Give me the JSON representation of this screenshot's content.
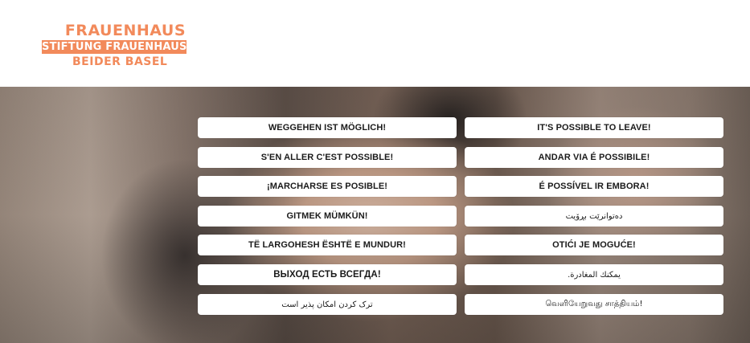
{
  "brand": {
    "line1": "FRAUENHAUS",
    "line2": "STIFTUNG FRAUENHAUS",
    "line3": "BEIDER BASEL",
    "color": "#f28a5b"
  },
  "languages": {
    "left": [
      "WEGGEHEN IST MÖGLICH!",
      "S'EN ALLER C'EST POSSIBLE!",
      "¡MARCHARSE ES POSIBLE!",
      "GITMEK MÜMKÜN!",
      "TË LARGOHESH ËSHTË E MUNDUR!",
      "ВЫХОД ЕСТЬ ВСЕГДА!",
      "ترک کردن امکان پذیر است"
    ],
    "right": [
      "IT'S POSSIBLE TO LEAVE!",
      "ANDAR VIA É POSSIBILE!",
      "É POSSÍVEL IR EMBORA!",
      "دەتوانرێت بڕۆیت",
      "OTIĆI JE MOGUĆE!",
      "يمكنك المغادرة.",
      "வெளியேறுவது சாத்தியம்!"
    ]
  }
}
